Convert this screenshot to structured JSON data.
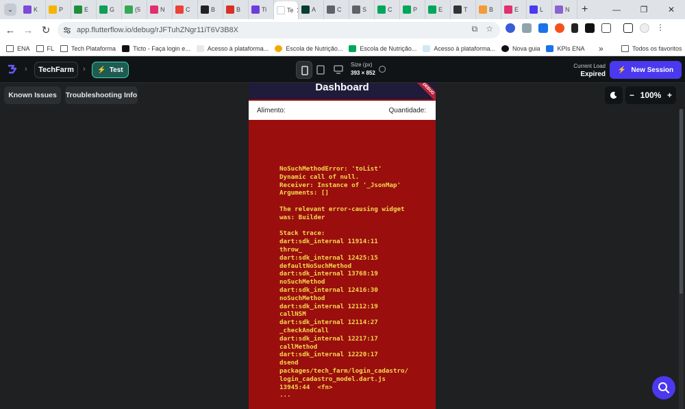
{
  "browser": {
    "tabs": [
      {
        "label": "K",
        "color": "#7b4bd6"
      },
      {
        "label": "P",
        "color": "#f4b400"
      },
      {
        "label": "E",
        "color": "#1e8e3e"
      },
      {
        "label": "G",
        "color": "#0f9d58"
      },
      {
        "label": "(5",
        "color": "#34a853"
      },
      {
        "label": "N",
        "color": "#e1306c"
      },
      {
        "label": "C",
        "color": "#ea4335"
      },
      {
        "label": "B",
        "color": "#222222"
      },
      {
        "label": "B",
        "color": "#d93025"
      },
      {
        "label": "Ti",
        "color": "#6c3dd9"
      },
      {
        "label": "A",
        "color": "#0b3d2e"
      },
      {
        "label": "C",
        "color": "#5f6368"
      },
      {
        "label": "S",
        "color": "#5f6368"
      },
      {
        "label": "C",
        "color": "#00a65a"
      },
      {
        "label": "P",
        "color": "#00a65a"
      },
      {
        "label": "E",
        "color": "#00a65a"
      },
      {
        "label": "T",
        "color": "#333333"
      },
      {
        "label": "B",
        "color": "#f29b38"
      },
      {
        "label": "E",
        "color": "#e1306c"
      },
      {
        "label": "L",
        "color": "#4b39ef"
      },
      {
        "label": "N",
        "color": "#8a63d2"
      }
    ],
    "active_tab": {
      "label": "Te",
      "close": "✕"
    },
    "new_tab": "+",
    "window_controls": [
      "—",
      "❐",
      "✕"
    ],
    "url": "app.flutterflow.io/debug/rJFTuhZNgr11iT6V3B8X",
    "bookmarks": [
      {
        "label": "ENA",
        "icon": "folder"
      },
      {
        "label": "FL",
        "icon": "folder"
      },
      {
        "label": "Tech Plataforma",
        "icon": "folder"
      },
      {
        "label": "Ticto - Faça login e...",
        "icon": "ticto"
      },
      {
        "label": "Acesso à plataforma...",
        "icon": "ena"
      },
      {
        "label": "Escola de Nutrição...",
        "icon": "escola"
      },
      {
        "label": "Escola de Nutrição...",
        "icon": "green"
      },
      {
        "label": "Acesso à plataforma...",
        "icon": "cloud"
      },
      {
        "label": "Nova guia",
        "icon": "globe"
      },
      {
        "label": "KPIs ENA",
        "icon": "chart"
      }
    ],
    "more_bookmarks": "»",
    "all_bookmarks": "Todos os favoritos"
  },
  "app": {
    "project_name": "TechFarm",
    "test_label": "Test",
    "size_label": "Size (px)",
    "size_value": "393 × 852",
    "current_load_label": "Current Load",
    "current_load_value": "Expired",
    "new_session_label": "New Session",
    "known_issues_label": "Known Issues",
    "troubleshooting_label": "Troubleshooting Info",
    "zoom_value": "100%",
    "zoom_minus": "−",
    "zoom_plus": "+"
  },
  "preview": {
    "title": "Dashboard",
    "debug_banner": "DEBUG",
    "col_alimento": "Alimento:",
    "col_quantidade": "Quantidade:",
    "error_text": "NoSuchMethodError: 'toList'\nDynamic call of null.\nReceiver: Instance of '_JsonMap'\nArguments: []\n\nThe relevant error-causing widget\nwas: Builder\n\nStack trace:\ndart:sdk_internal 11914:11\nthrow_\ndart:sdk_internal 12425:15\ndefaultNoSuchMethod\ndart:sdk_internal 13768:19\nnoSuchMethod\ndart:sdk_internal 12416:30\nnoSuchMethod\ndart:sdk_internal 12112:19\ncallNSM\ndart:sdk_internal 12114:27\n_checkAndCall\ndart:sdk_internal 12217:17\ncallMethod\ndart:sdk_internal 12220:17\ndsend\npackages/tech_farm/login_cadastro/\nlogin_cadastro_model.dart.js\n13945:44  <fn>\n..."
  }
}
